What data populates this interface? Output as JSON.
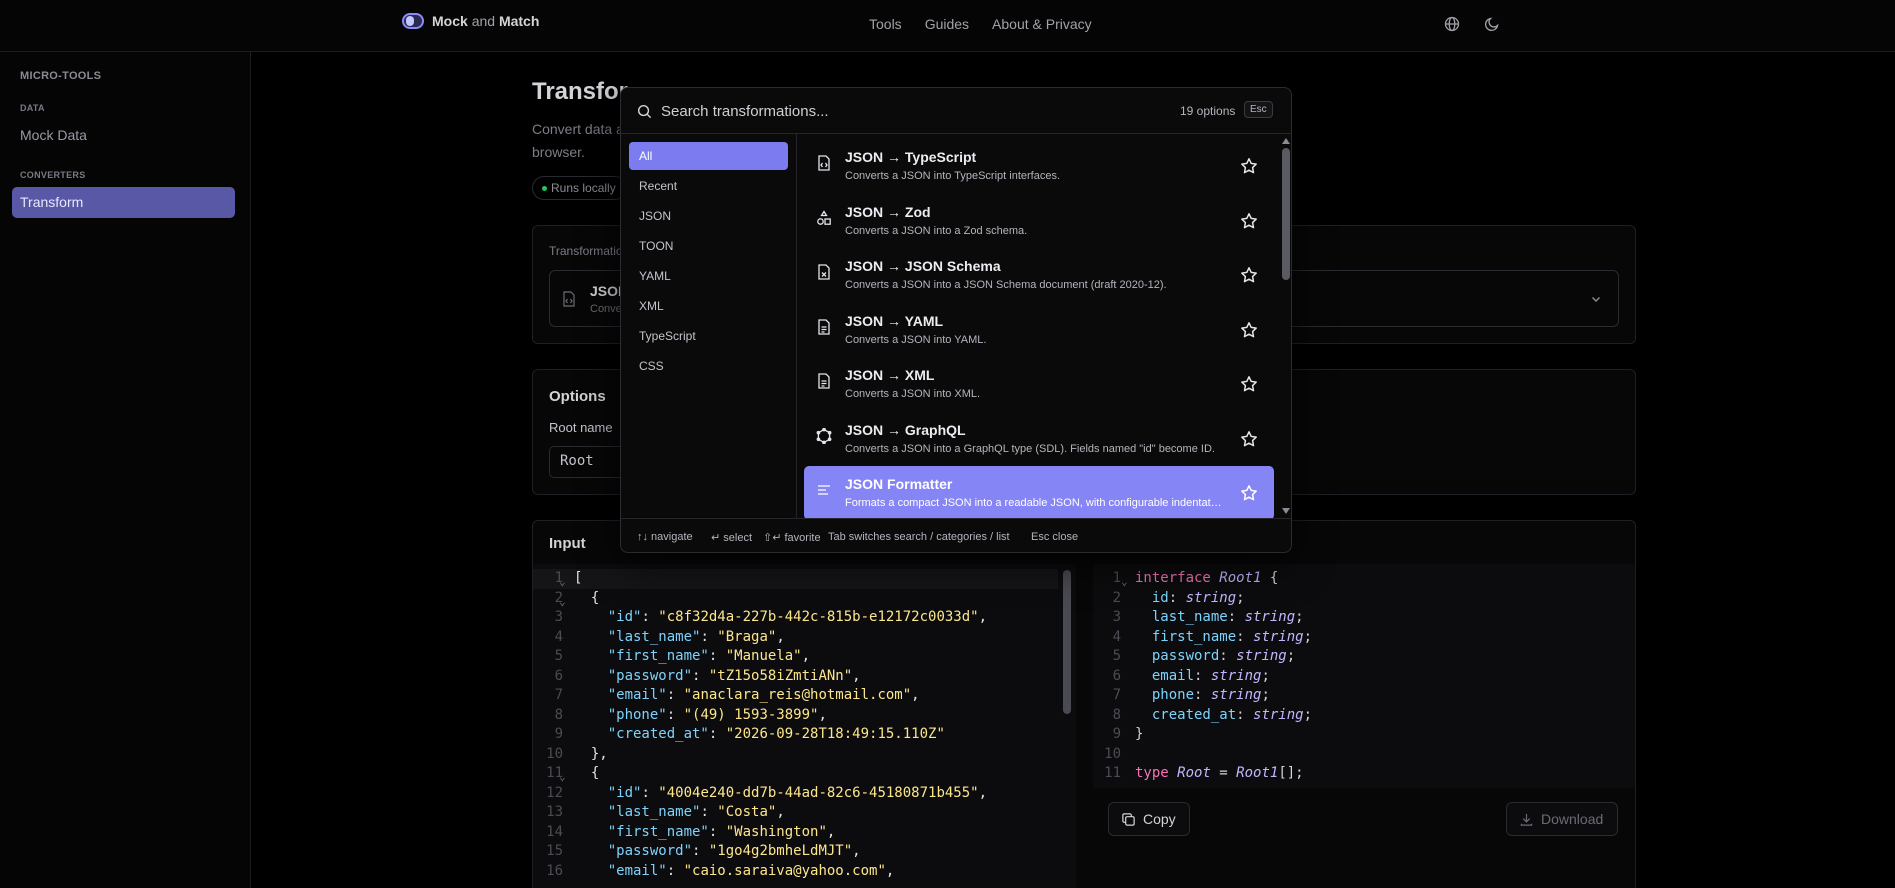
{
  "app": {
    "brand_bold": "Mock",
    "brand_mid": "and",
    "brand_end": "Match",
    "nav": [
      "Tools",
      "Guides",
      "About & Privacy"
    ]
  },
  "sidebar": {
    "title": "MICRO-TOOLS",
    "groups": [
      {
        "label": "DATA",
        "items": [
          {
            "label": "Mock Data"
          }
        ]
      },
      {
        "label": "CONVERTERS",
        "items": [
          {
            "label": "Transform"
          }
        ]
      }
    ]
  },
  "main": {
    "title": "Transfor",
    "desc_1": "Convert data a",
    "desc_2": "browser.",
    "badge": "Runs locally",
    "transformation_label": "Transformatio",
    "selected_title": "JSON",
    "selected_desc": "Conve",
    "options_heading": "Options",
    "root_name_label": "Root name",
    "root_name_value": "Root",
    "input_heading": "Input",
    "copy_label": "Copy",
    "download_label": "Download"
  },
  "input_lines": [
    {
      "n": "1",
      "fold": "⌄",
      "code": "["
    },
    {
      "n": "2",
      "fold": "⌄",
      "code": "  {"
    },
    {
      "n": "3",
      "fold": "",
      "code": "    \"id\": \"c8f32d4a-227b-442c-815b-e12172c0033d\","
    },
    {
      "n": "4",
      "fold": "",
      "code": "    \"last_name\": \"Braga\","
    },
    {
      "n": "5",
      "fold": "",
      "code": "    \"first_name\": \"Manuela\","
    },
    {
      "n": "6",
      "fold": "",
      "code": "    \"password\": \"tZ15o58iZmtiANn\","
    },
    {
      "n": "7",
      "fold": "",
      "code": "    \"email\": \"anaclara_reis@hotmail.com\","
    },
    {
      "n": "8",
      "fold": "",
      "code": "    \"phone\": \"(49) 1593-3899\","
    },
    {
      "n": "9",
      "fold": "",
      "code": "    \"created_at\": \"2026-09-28T18:49:15.110Z\""
    },
    {
      "n": "10",
      "fold": "",
      "code": "  },"
    },
    {
      "n": "11",
      "fold": "⌄",
      "code": "  {"
    },
    {
      "n": "12",
      "fold": "",
      "code": "    \"id\": \"4004e240-dd7b-44ad-82c6-45180871b455\","
    },
    {
      "n": "13",
      "fold": "",
      "code": "    \"last_name\": \"Costa\","
    },
    {
      "n": "14",
      "fold": "",
      "code": "    \"first_name\": \"Washington\","
    },
    {
      "n": "15",
      "fold": "",
      "code": "    \"password\": \"1go4g2bmheLdMJT\","
    },
    {
      "n": "16",
      "fold": "",
      "code": "    \"email\": \"caio.saraiva@yahoo.com\","
    }
  ],
  "output_lines": [
    {
      "n": "1",
      "fold": "⌄",
      "code": "interface Root1 {"
    },
    {
      "n": "2",
      "fold": "",
      "code": "  id: string;"
    },
    {
      "n": "3",
      "fold": "",
      "code": "  last_name: string;"
    },
    {
      "n": "4",
      "fold": "",
      "code": "  first_name: string;"
    },
    {
      "n": "5",
      "fold": "",
      "code": "  password: string;"
    },
    {
      "n": "6",
      "fold": "",
      "code": "  email: string;"
    },
    {
      "n": "7",
      "fold": "",
      "code": "  phone: string;"
    },
    {
      "n": "8",
      "fold": "",
      "code": "  created_at: string;"
    },
    {
      "n": "9",
      "fold": "",
      "code": "}"
    },
    {
      "n": "10",
      "fold": "",
      "code": ""
    },
    {
      "n": "11",
      "fold": "",
      "code": "type Root = Root1[];"
    }
  ],
  "palette": {
    "placeholder": "Search transformations...",
    "count": "19 options",
    "esc": "Esc",
    "categories": [
      "All",
      "Recent",
      "JSON",
      "TOON",
      "YAML",
      "XML",
      "TypeScript",
      "CSS"
    ],
    "active_category": "All",
    "items": [
      {
        "title": "JSON → TypeScript",
        "desc": "Converts a JSON into TypeScript interfaces.",
        "icon": "file-code-icon"
      },
      {
        "title": "JSON → Zod",
        "desc": "Converts a JSON into a Zod schema.",
        "icon": "shapes-icon"
      },
      {
        "title": "JSON → JSON Schema",
        "desc": "Converts a JSON into a JSON Schema document (draft 2020-12).",
        "icon": "file-schema-icon"
      },
      {
        "title": "JSON → YAML",
        "desc": "Converts a JSON into YAML.",
        "icon": "file-text-icon"
      },
      {
        "title": "JSON → XML",
        "desc": "Converts a JSON into XML.",
        "icon": "file-text-icon"
      },
      {
        "title": "JSON → GraphQL",
        "desc": "Converts a JSON into a GraphQL type (SDL). Fields named \"id\" become ID.",
        "icon": "graphql-icon"
      },
      {
        "title": "JSON Formatter",
        "desc": "Formats a compact JSON into a readable JSON, with configurable indentation.",
        "icon": "align-left-icon"
      }
    ],
    "active_item": "JSON Formatter",
    "footer": {
      "navigate": "↑↓ navigate",
      "select": "↵ select",
      "favorite": "⇧↵ favorite",
      "tab": "Tab switches search / categories / list",
      "esc": "Esc close"
    }
  },
  "colors": {
    "accent": "#8585f5",
    "sidebar_active": "#5858a6",
    "json_key": "#7dd3fc",
    "json_string": "#fde68a",
    "ts_keyword": "#f472b6",
    "ts_type": "#c4b5fd"
  }
}
